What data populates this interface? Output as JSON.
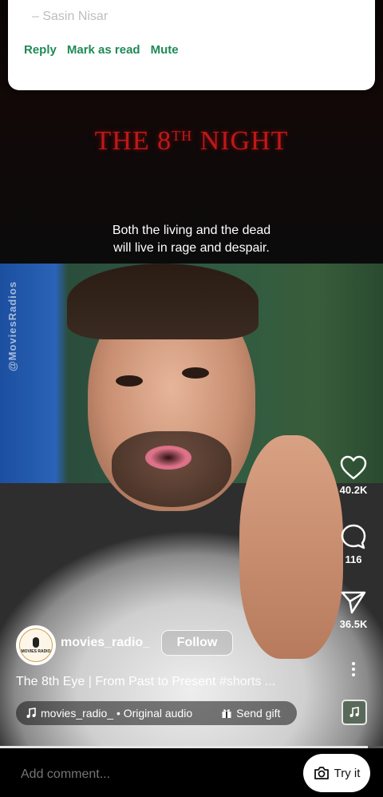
{
  "notification": {
    "sender": "– Sasin Nisar",
    "actions": [
      "Reply",
      "Mark as read",
      "Mute"
    ]
  },
  "video": {
    "movie_title_main": "THE 8",
    "movie_title_sup": "TH",
    "movie_title_end": " NIGHT",
    "subtitle": "Both the living and the dead\nwill live in rage and despair.",
    "watermark": "@MoviesRadios"
  },
  "rail": {
    "likes": "40.2K",
    "comments": "116",
    "shares": "36.5K"
  },
  "post": {
    "username": "movies_radio_",
    "follow_label": "Follow",
    "caption_text": "The 8th Eye | From Past to Present ",
    "caption_hashtag": "#shorts ...",
    "audio_label": "movies_radio_ • Original audio",
    "gift_label": "Send gift",
    "logo_text": "MOVIES RADIO"
  },
  "playback": {
    "progress_fraction": 0.96
  },
  "comment_bar": {
    "placeholder": "Add comment...",
    "try_it_label": "Try it"
  },
  "colors": {
    "notification_action": "#1e8a57",
    "movie_title": "#c01818"
  }
}
